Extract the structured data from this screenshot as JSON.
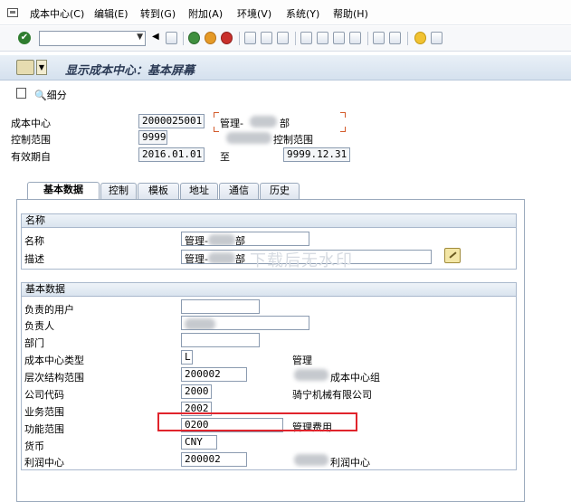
{
  "menu": {
    "items": [
      "成本中心(C)",
      "编辑(E)",
      "转到(G)",
      "附加(A)",
      "环境(V)",
      "系统(Y)",
      "帮助(H)"
    ]
  },
  "header": {
    "title": "显示成本中心：基本屏幕",
    "detail_label": "细分"
  },
  "summary": {
    "cost_center_label": "成本中心",
    "cost_center_value": "2000025001",
    "cost_center_name_prefix": "管理-",
    "cost_center_name_suffix": "部",
    "controlling_area_label": "控制范围",
    "controlling_area_value": "9999",
    "controlling_area_text": "控制范围",
    "valid_from_label": "有效期自",
    "valid_from_value": "2016.01.01",
    "valid_to_label": "至",
    "valid_to_value": "9999.12.31"
  },
  "tabs": [
    "基本数据",
    "控制",
    "模板",
    "地址",
    "通信",
    "历史"
  ],
  "names_group": {
    "title": "名称",
    "name_label": "名称",
    "name_value_prefix": "管理-",
    "name_value_suffix": "部",
    "desc_label": "描述",
    "desc_value_prefix": "管理-",
    "desc_value_suffix": "部"
  },
  "basic_group": {
    "title": "基本数据",
    "responsible_user_label": "负责的用户",
    "responsible_person_label": "负责人",
    "department_label": "部门",
    "cc_category_label": "成本中心类型",
    "cc_category_value": "L",
    "cc_category_text": "管理",
    "hierarchy_area_label": "层次结构范围",
    "hierarchy_area_value": "200002",
    "hierarchy_area_text": "成本中心组",
    "company_code_label": "公司代码",
    "company_code_value": "2000",
    "company_code_text": "骑宁机械有限公司",
    "business_area_label": "业务范围",
    "business_area_value": "2002",
    "functional_area_label": "功能范围",
    "functional_area_value": "0200",
    "functional_area_text": "管理费用",
    "currency_label": "货币",
    "currency_value": "CNY",
    "profit_center_label": "利润中心",
    "profit_center_value": "200002",
    "profit_center_text": "利润中心"
  },
  "watermark": "下载后无水印",
  "colors": {
    "highlight": "#e0242c",
    "title_bar": "#d5e1ee",
    "field_border": "#8b9bb0"
  }
}
